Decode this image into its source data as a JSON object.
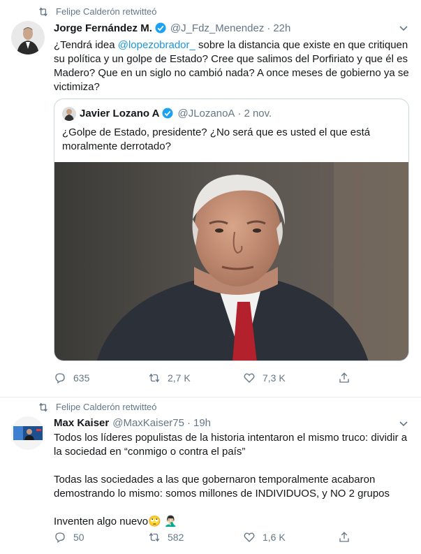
{
  "tweets": [
    {
      "retweet_label": "Felipe Calderón retwitteó",
      "author_name": "Jorge Fernández M.",
      "author_handle": "@J_Fdz_Menendez",
      "separator": "·",
      "time": "22h",
      "text_parts": {
        "l1a": "¿Tendrá idea ",
        "mention": "@lopezobrador_",
        "l1b": " sobre la distancia que existe en que critiquen",
        "l2": "su política y un golpe de Estado? Cree que salimos del Porfiriato y que él es",
        "l3": "Madero? Que en un siglo no cambió nada? A once meses de gobierno ya se",
        "l4": "victimiza?"
      },
      "quoted": {
        "author_name": "Javier Lozano A",
        "author_handle": "@JLozanoA",
        "separator": "·",
        "time": "2 nov.",
        "text_lines": [
          "¿Golpe de Estado, presidente? ¿No será que es usted el que está",
          "moralmente derrotado?"
        ]
      },
      "actions": {
        "replies": "635",
        "retweets": "2,7 K",
        "likes": "7,3 K"
      }
    },
    {
      "retweet_label": "Felipe Calderón retwitteó",
      "author_name": "Max Kaiser",
      "author_handle": "@MaxKaiser75",
      "separator": "·",
      "time": "19h",
      "text_lines": [
        "Todos los líderes populistas de la historia intentaron el mismo truco: dividir a",
        "la sociedad en “conmigo o contra el país”",
        "",
        "Todas las sociedades a las que gobernaron temporalmente acabaron",
        "demostrando lo mismo: somos millones de INDIVIDUOS, y NO 2 grupos",
        "",
        "Inventen algo nuevo"
      ],
      "emoji": "🙄 🤦🏻‍♂️",
      "actions": {
        "replies": "50",
        "retweets": "582",
        "likes": "1,6 K"
      }
    }
  ],
  "colors": {
    "link": "#1b95e0",
    "secondary": "#657786",
    "verified": "#1da1f2",
    "border": "#e6ecf0"
  }
}
